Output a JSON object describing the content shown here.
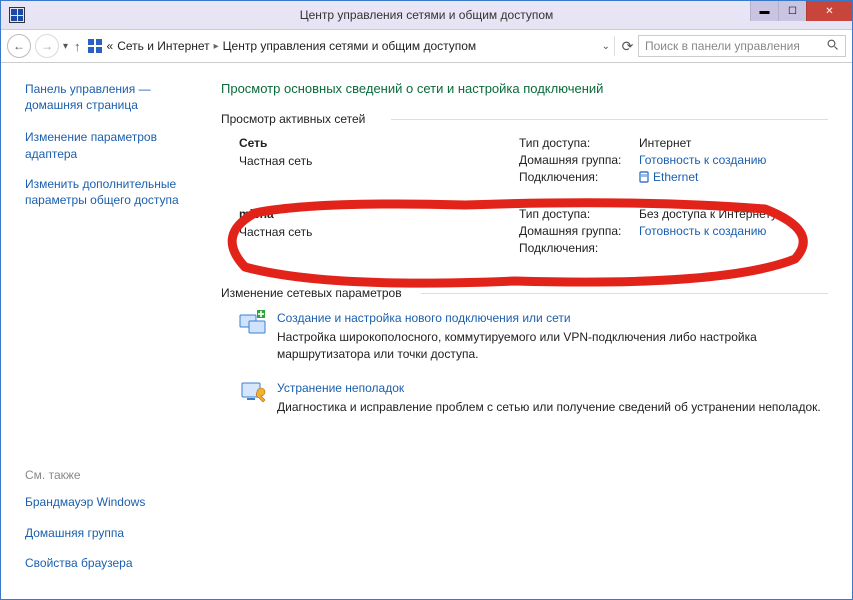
{
  "window": {
    "title": "Центр управления сетями и общим доступом"
  },
  "breadcrumb": {
    "prefix": "«",
    "item1": "Сеть и Интернет",
    "item2": "Центр управления сетями и общим доступом"
  },
  "search": {
    "placeholder": "Поиск в панели управления"
  },
  "sidebar": {
    "home": "Панель управления — домашняя страница",
    "link1": "Изменение параметров адаптера",
    "link2": "Изменить дополнительные параметры общего доступа",
    "see_also": "См. также",
    "bottom1": "Брандмауэр Windows",
    "bottom2": "Домашняя группа",
    "bottom3": "Свойства браузера"
  },
  "page": {
    "title": "Просмотр основных сведений о сети и настройка подключений",
    "group1": "Просмотр активных сетей",
    "group2": "Изменение сетевых параметров"
  },
  "labels": {
    "access_type": "Тип доступа:",
    "homegroup": "Домашняя группа:",
    "connections": "Подключения:"
  },
  "networks": [
    {
      "name": "Сеть",
      "type": "Частная сеть",
      "access": "Интернет",
      "homegroup": "Готовность к созданию",
      "conn": "Ethernet"
    },
    {
      "name": "misha",
      "type": "Частная сеть",
      "access": "Без доступа к Интернету",
      "homegroup": "Готовность к созданию",
      "conn": ""
    }
  ],
  "settings": [
    {
      "title": "Создание и настройка нового подключения или сети",
      "desc": "Настройка широкополосного, коммутируемого или VPN-подключения либо настройка маршрутизатора или точки доступа."
    },
    {
      "title": "Устранение неполадок",
      "desc": "Диагностика и исправление проблем с сетью или получение сведений об устранении неполадок."
    }
  ]
}
